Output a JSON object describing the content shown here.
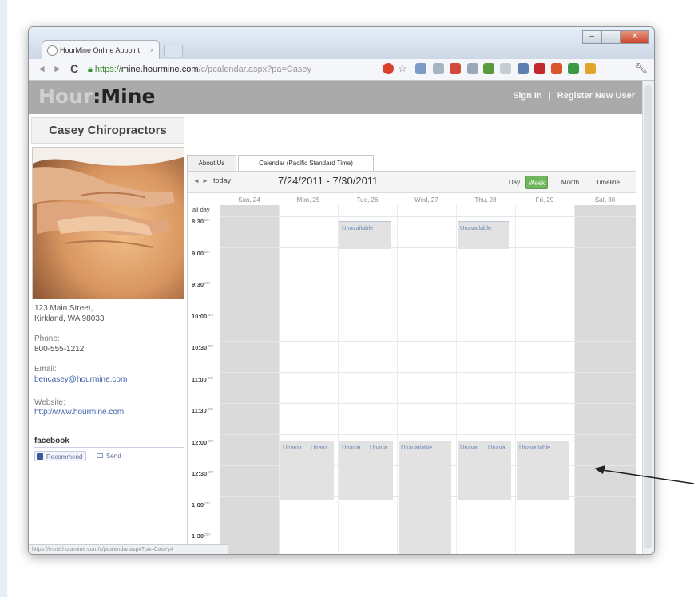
{
  "browser": {
    "tab_title": "HourMine Online Appoint",
    "tab_close": "×",
    "url_scheme": "https://",
    "url_host": "mine.hourmine.com",
    "url_path": "/c/pcalendar.aspx?pa=Casey",
    "status_url": "https://mine.hourmine.com/c/pcalendar.aspx?pa=Casey#"
  },
  "site": {
    "logo_part1": "Hour",
    "logo_part2": ":Mine",
    "sign_in": "Sign In",
    "separator": "|",
    "register": "Register New User"
  },
  "business": {
    "name": "Casey Chiropractors",
    "address_line1": "123 Main Street,",
    "address_line2": "Kirkland, WA 98033",
    "phone_label": "Phone:",
    "phone": "800-555-1212",
    "email_label": "Email:",
    "email": "bencasey@hourmine.com",
    "website_label": "Website:",
    "website": "http://www.hourmine.com",
    "facebook_heading": "facebook",
    "recommend_label": "Recommend",
    "send_label": "Send"
  },
  "calendar": {
    "tabs": [
      "About Us",
      "Calendar (Pacific Standard Time)"
    ],
    "prev_label": "◄",
    "next_label": "►",
    "today_label": "today",
    "toolbar_dash": "–",
    "date_range": "7/24/2011 - 7/30/2011",
    "views": [
      "Day",
      "Week",
      "Month",
      "Timeline"
    ],
    "days": [
      "Sun, 24",
      "Mon, 25",
      "Tue, 26",
      "Wed, 27",
      "Thu, 28",
      "Fri, 29",
      "Sat, 30"
    ],
    "allday_label": "all day",
    "times": [
      "8:30",
      "9:00",
      "9:30",
      "10:00",
      "10:30",
      "11:00",
      "11:30",
      "12:00",
      "12:30",
      "1:00",
      "1:30"
    ],
    "ampm": [
      "am",
      "am",
      "am",
      "am",
      "am",
      "am",
      "am",
      "pm",
      "pm",
      "pm",
      "pm"
    ],
    "events": {
      "tue_morning": "Unavailable",
      "thu_morning": "Unavailable",
      "mon_noon_a": "Unavai",
      "mon_noon_b": "Unava",
      "tue_noon_a": "Unavai",
      "tue_noon_b": "Unava",
      "wed_noon": "Unavailable",
      "thu_noon_a": "Unavai",
      "thu_noon_b": "Unava",
      "fri_noon": "Unavailable"
    }
  },
  "colors": {
    "header_bg": "#a9aaa9",
    "active_view": "#6fb65e",
    "closed_day": "#dadada",
    "event_text": "#6c8bb5",
    "link": "#3d5fa8"
  }
}
